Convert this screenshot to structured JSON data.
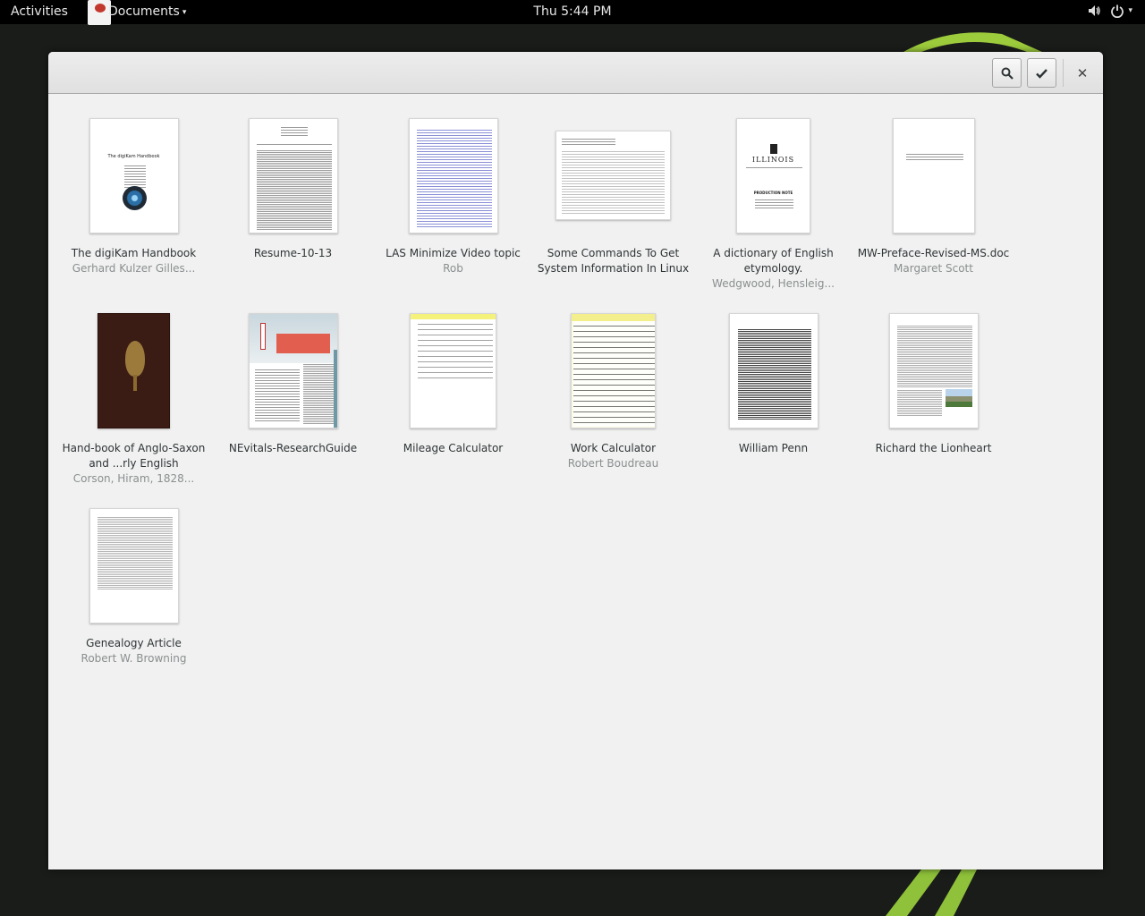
{
  "topbar": {
    "activities": "Activities",
    "app_name": "Documents",
    "app_menu_arrow": "▾",
    "clock": "Thu  5:44 PM",
    "volume_icon": "volume-icon",
    "power_icon": "power-icon",
    "power_arrow": "▾"
  },
  "header": {
    "search_icon": "search-icon",
    "select_icon": "checkmark-icon",
    "close_label": "✕"
  },
  "documents": [
    {
      "title": "The digiKam Handbook",
      "author": "Gerhard Kulzer  Gilles..."
    },
    {
      "title": "Resume-10-13",
      "author": ""
    },
    {
      "title": "LAS Minimize Video topic",
      "author": "Rob"
    },
    {
      "title": "Some Commands To Get System Information In Linux",
      "author": ""
    },
    {
      "title": "A dictionary of English etymology.",
      "author": "Wedgwood, Hensleig..."
    },
    {
      "title": "MW-Preface-Revised-MS.doc",
      "author": "Margaret Scott"
    },
    {
      "title": "Hand-book of Anglo-Saxon and ...rly English",
      "author": "Corson, Hiram, 1828..."
    },
    {
      "title": "NEvitals-ResearchGuide",
      "author": ""
    },
    {
      "title": "Mileage Calculator",
      "author": ""
    },
    {
      "title": "Work Calculator",
      "author": "Robert Boudreau"
    },
    {
      "title": "William Penn",
      "author": ""
    },
    {
      "title": "Richard the Lionheart",
      "author": ""
    },
    {
      "title": "Genealogy Article",
      "author": "Robert W. Browning"
    }
  ],
  "thumb_text": {
    "digikam_title": "The digiKam Handbook",
    "illinois": "ILLINOIS",
    "production_note": "PRODUCTION NOTE"
  },
  "colors": {
    "accent_green": "#8fc23a",
    "window_bg": "#f1f1f1"
  }
}
